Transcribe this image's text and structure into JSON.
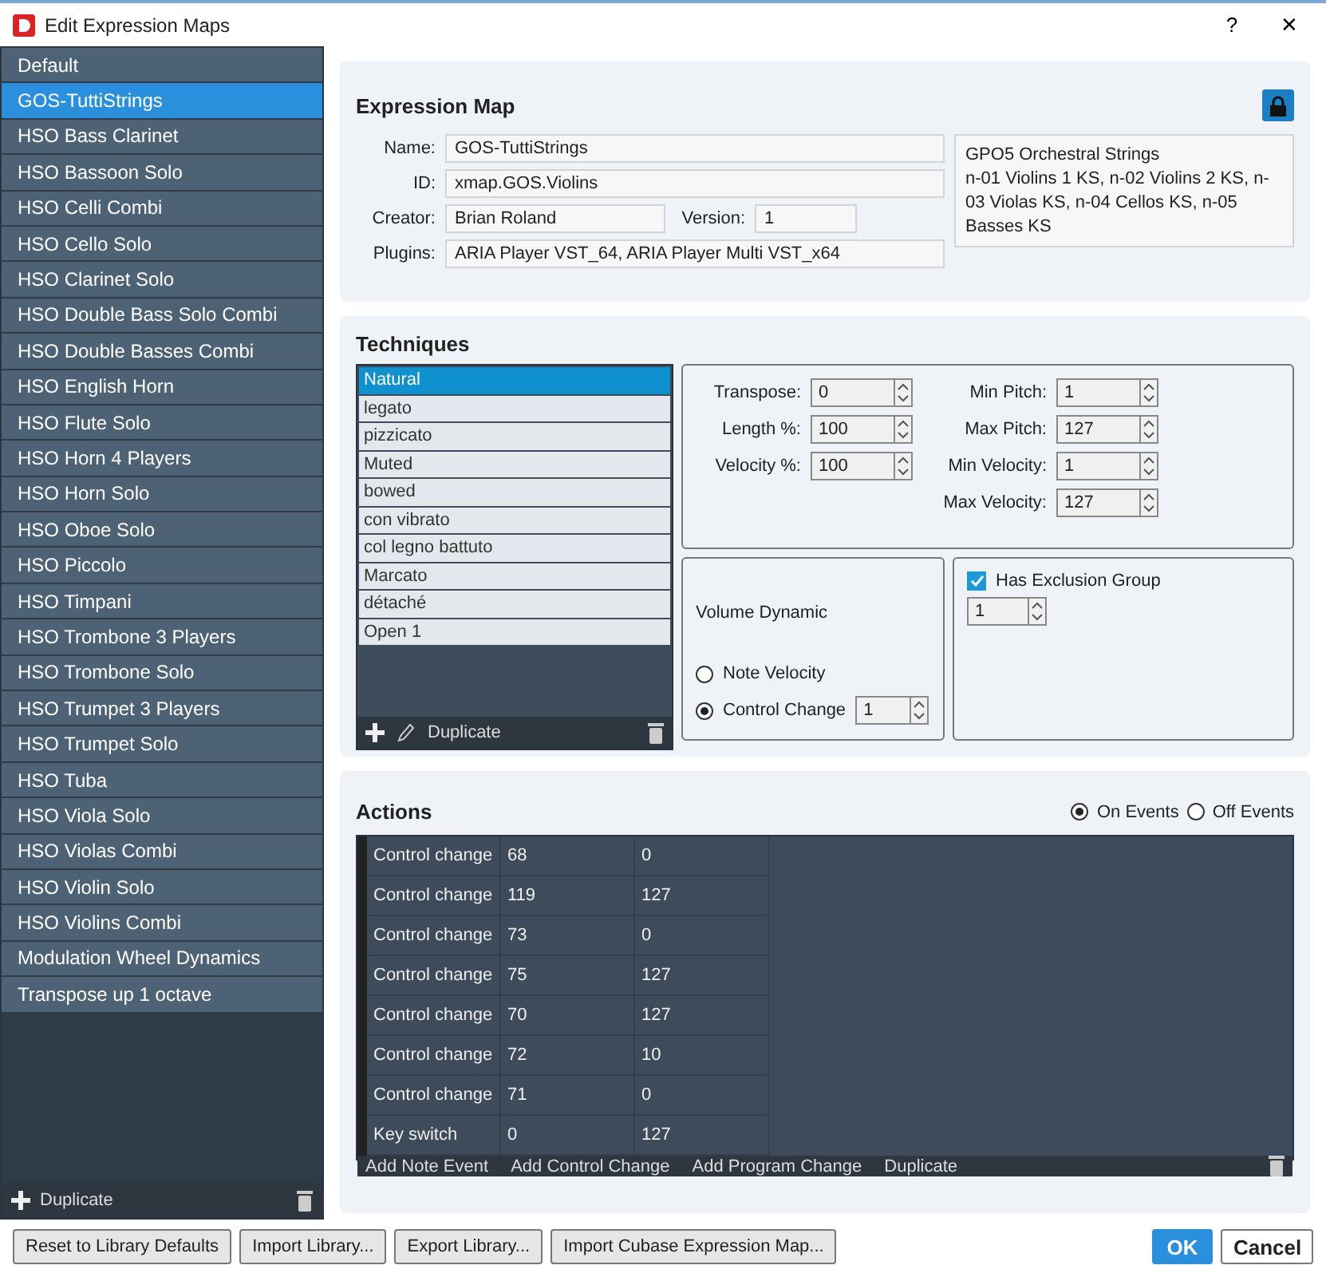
{
  "window": {
    "title": "Edit Expression Maps",
    "help": "?",
    "close": "✕"
  },
  "maps": [
    {
      "label": "Default",
      "selected": false
    },
    {
      "label": "GOS-TuttiStrings",
      "selected": true
    },
    {
      "label": "HSO Bass Clarinet",
      "selected": false
    },
    {
      "label": "HSO Bassoon Solo",
      "selected": false
    },
    {
      "label": "HSO Celli Combi",
      "selected": false
    },
    {
      "label": "HSO Cello Solo",
      "selected": false
    },
    {
      "label": "HSO Clarinet Solo",
      "selected": false
    },
    {
      "label": "HSO Double Bass Solo Combi",
      "selected": false
    },
    {
      "label": "HSO Double Basses Combi",
      "selected": false
    },
    {
      "label": "HSO English Horn",
      "selected": false
    },
    {
      "label": "HSO Flute Solo",
      "selected": false
    },
    {
      "label": "HSO Horn 4 Players",
      "selected": false
    },
    {
      "label": "HSO Horn Solo",
      "selected": false
    },
    {
      "label": "HSO Oboe Solo",
      "selected": false
    },
    {
      "label": "HSO Piccolo",
      "selected": false
    },
    {
      "label": "HSO Timpani",
      "selected": false
    },
    {
      "label": "HSO Trombone 3 Players",
      "selected": false
    },
    {
      "label": "HSO Trombone Solo",
      "selected": false
    },
    {
      "label": "HSO Trumpet 3 Players",
      "selected": false
    },
    {
      "label": "HSO Trumpet Solo",
      "selected": false
    },
    {
      "label": "HSO Tuba",
      "selected": false
    },
    {
      "label": "HSO Viola Solo",
      "selected": false
    },
    {
      "label": "HSO Violas Combi",
      "selected": false
    },
    {
      "label": "HSO Violin Solo",
      "selected": false
    },
    {
      "label": "HSO Violins Combi",
      "selected": false
    },
    {
      "label": "Modulation Wheel Dynamics",
      "selected": false
    },
    {
      "label": "Transpose up 1 octave",
      "selected": false
    }
  ],
  "maps_footer": {
    "duplicate": "Duplicate"
  },
  "expression_map": {
    "title": "Expression Map",
    "name_label": "Name:",
    "name": "GOS-TuttiStrings",
    "id_label": "ID:",
    "id": "xmap.GOS.Violins",
    "creator_label": "Creator:",
    "creator": "Brian Roland",
    "version_label": "Version:",
    "version": "1",
    "plugins_label": "Plugins:",
    "plugins": "ARIA Player VST_64, ARIA Player Multi VST_x64",
    "description": "GPO5 Orchestral Strings\nn-01 Violins 1 KS, n-02 Violins 2 KS, n-03 Violas KS, n-04 Cellos KS, n-05 Basses KS"
  },
  "techniques": {
    "title": "Techniques",
    "items": [
      {
        "label": "Natural",
        "selected": true
      },
      {
        "label": "legato",
        "selected": false
      },
      {
        "label": "pizzicato",
        "selected": false
      },
      {
        "label": "Muted",
        "selected": false
      },
      {
        "label": "bowed",
        "selected": false
      },
      {
        "label": "con vibrato",
        "selected": false
      },
      {
        "label": "col legno battuto",
        "selected": false
      },
      {
        "label": "Marcato",
        "selected": false
      },
      {
        "label": "détaché",
        "selected": false
      },
      {
        "label": "Open 1",
        "selected": false
      }
    ],
    "duplicate": "Duplicate",
    "left_params": [
      {
        "label": "Transpose:",
        "value": "0"
      },
      {
        "label": "Length %:",
        "value": "100"
      },
      {
        "label": "Velocity %:",
        "value": "100"
      }
    ],
    "right_params": [
      {
        "label": "Min Pitch:",
        "value": "1"
      },
      {
        "label": "Max Pitch:",
        "value": "127"
      },
      {
        "label": "Min Velocity:",
        "value": "1"
      },
      {
        "label": "Max Velocity:",
        "value": "127"
      }
    ],
    "volume_dynamic": {
      "title": "Volume Dynamic",
      "options": [
        {
          "label": "Note Velocity",
          "selected": false
        },
        {
          "label": "Control Change",
          "selected": true
        }
      ],
      "cc_value": "1"
    },
    "exclusion": {
      "label": "Has Exclusion Group",
      "checked": true,
      "value": "1"
    }
  },
  "actions": {
    "title": "Actions",
    "event_options": [
      {
        "label": "On Events",
        "selected": true
      },
      {
        "label": "Off Events",
        "selected": false
      }
    ],
    "rows": [
      [
        "Control change",
        "68",
        "0"
      ],
      [
        "Control change",
        "119",
        "127"
      ],
      [
        "Control change",
        "73",
        "0"
      ],
      [
        "Control change",
        "75",
        "127"
      ],
      [
        "Control change",
        "70",
        "127"
      ],
      [
        "Control change",
        "72",
        "10"
      ],
      [
        "Control change",
        "71",
        "0"
      ],
      [
        "Key switch",
        "0",
        "127"
      ]
    ],
    "toolbar": [
      "Add Note Event",
      "Add Control Change",
      "Add Program Change",
      "Duplicate"
    ]
  },
  "bottom_buttons": [
    "Reset to Library Defaults",
    "Import Library...",
    "Export Library...",
    "Import Cubase Expression Map..."
  ],
  "ok": "OK",
  "cancel": "Cancel"
}
